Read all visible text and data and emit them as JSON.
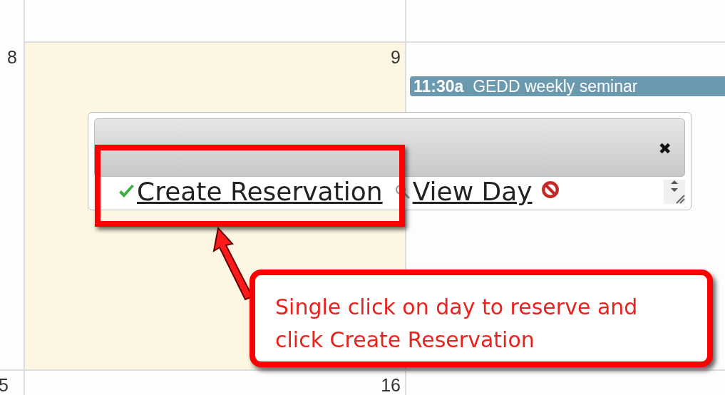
{
  "weeks": [
    {
      "days": [
        {
          "number": "8",
          "selected": false
        },
        {
          "number": "9",
          "selected": true
        },
        {
          "selected": false,
          "events": [
            {
              "time": "11:30a",
              "title": "GEDD weekly seminar",
              "color": "#6b99af"
            }
          ]
        }
      ]
    },
    {
      "days": [
        {
          "number": "5",
          "selected": false
        },
        {
          "number": "16",
          "selected": false
        }
      ]
    }
  ],
  "popup": {
    "close": "✖",
    "actions": [
      {
        "kind": "create",
        "label": "Create Reservation"
      },
      {
        "kind": "view",
        "label": "View Day"
      },
      {
        "kind": "cancel"
      }
    ]
  },
  "callout": {
    "text": "Single click on day to reserve and click Create Reservation"
  }
}
